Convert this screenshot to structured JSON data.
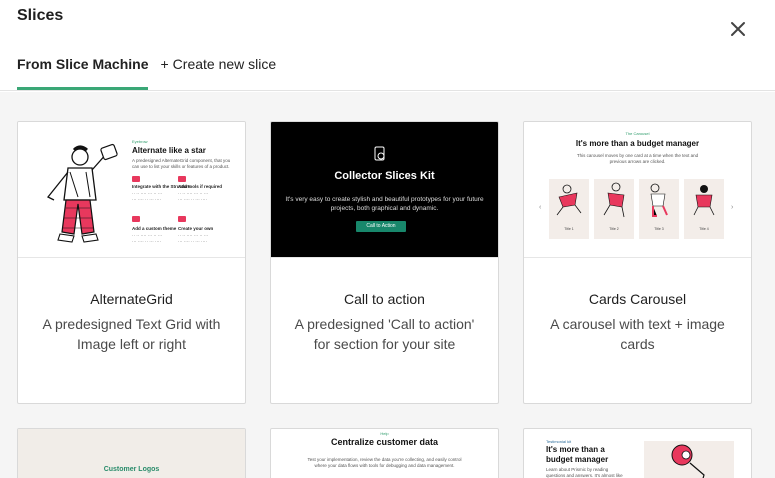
{
  "header": {
    "title": "Slices",
    "tabs": [
      {
        "label": "From Slice Machine",
        "active": true
      },
      {
        "label": "Create new slice",
        "prefix": "+",
        "active": false
      }
    ]
  },
  "cards": [
    {
      "name": "AlternateGrid",
      "description": "A predesigned Text Grid with Image left or right",
      "thumb": {
        "eyebrow": "Eyebrow",
        "heading": "Alternate like a star",
        "subtitle": "A predesigned AlternateGrid component, that you can use to list your skills or features of a product.",
        "items": [
          "Integrate with the Structure",
          "Add tools if required",
          "Add a custom theme",
          "Create your own"
        ]
      }
    },
    {
      "name": "Call to action",
      "description": "A predesigned 'Call to action' for section for your site",
      "thumb": {
        "heading": "Collector Slices Kit",
        "subtitle": "It's very easy to create stylish and beautiful prototypes for your future projects, both graphical and dynamic.",
        "button": "Call to Action"
      }
    },
    {
      "name": "Cards Carousel",
      "description": "A carousel with text + image cards",
      "thumb": {
        "eyebrow": "The Carousel",
        "heading": "It's more than a budget manager",
        "subtitle": "This carousel moves by one card at a time when the text and previous arrows are clicked.",
        "slides": [
          "Title 1",
          "Title 2",
          "Title 3",
          "Title 4"
        ]
      }
    }
  ],
  "partial_cards": [
    {
      "thumb_label": "Customer Logos"
    },
    {
      "eyebrow": "Help",
      "heading": "Centralize customer data",
      "subtitle": "Test your implementation, review the data you're collecting, and easily control where your data flows with tools for debugging and data management."
    },
    {
      "eyebrow": "Testimonial kit",
      "heading": "It's more than a budget manager",
      "subtitle": "Learn about Prismic by reading questions and answers. It's almost like talking to a human - and"
    }
  ],
  "colors": {
    "accent": "#3aa776",
    "cta_button": "#18876b",
    "illustration_red": "#e8385d"
  }
}
